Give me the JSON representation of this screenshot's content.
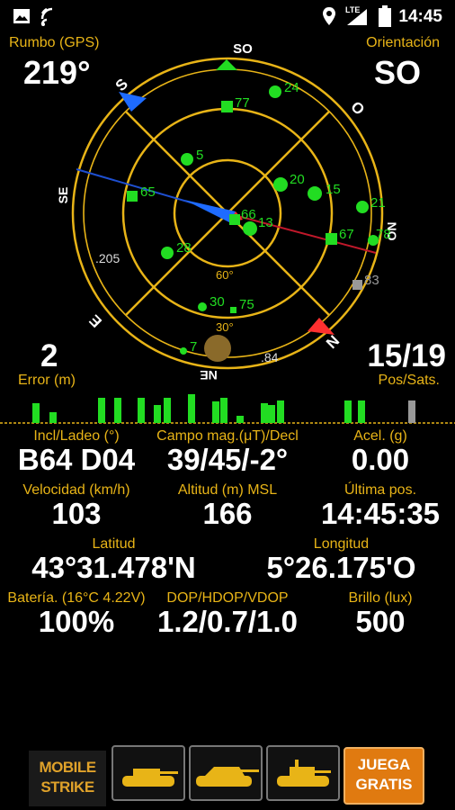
{
  "status_bar": {
    "time": "14:45",
    "lte_label": "LTE"
  },
  "header": {
    "heading_label": "Rumbo (GPS)",
    "heading_value": "219°",
    "orientation_label": "Orientación",
    "orientation_value": "SO"
  },
  "radar": {
    "cardinals": {
      "top": "SO",
      "left_top": "S",
      "right_top": "O",
      "left": "SE",
      "right": "NO",
      "left_bottom": "E",
      "right_bottom": "N",
      "bottom": "NE"
    },
    "ring_labels": {
      "inner": "60°",
      "outer": "30°"
    },
    "side_labels": {
      "left": ".205",
      "right_bottom": ".84"
    },
    "satellites": [
      {
        "id": "24"
      },
      {
        "id": "77"
      },
      {
        "id": "5"
      },
      {
        "id": "65"
      },
      {
        "id": "20"
      },
      {
        "id": "15"
      },
      {
        "id": "21"
      },
      {
        "id": "66"
      },
      {
        "id": "13"
      },
      {
        "id": "67"
      },
      {
        "id": "78"
      },
      {
        "id": "28"
      },
      {
        "id": "83"
      },
      {
        "id": "30"
      },
      {
        "id": "75"
      },
      {
        "id": "7"
      }
    ]
  },
  "mid": {
    "error_value": "2",
    "error_label": "Error (m)",
    "possats_value": "15/19",
    "possats_label": "Pos/Sats."
  },
  "signal_bars": [
    22,
    12,
    28,
    28,
    28,
    20,
    28,
    32,
    24,
    28,
    8,
    22,
    20,
    25,
    25,
    25,
    25,
    14,
    24,
    20
  ],
  "stats": {
    "r1": {
      "incl_label": "Incl/Ladeo (°)",
      "incl_value": "B64 D04",
      "mag_label": "Campo mag.(μT)/Decl",
      "mag_value": "39/45/-2°",
      "acel_label": "Acel. (g)",
      "acel_value": "0.00"
    },
    "r2": {
      "vel_label": "Velocidad (km/h)",
      "vel_value": "103",
      "alt_label": "Altitud (m) MSL",
      "alt_value": "166",
      "last_label": "Última pos.",
      "last_value": "14:45:35"
    },
    "r3": {
      "lat_label": "Latitud",
      "lat_value": "43°31.478'N",
      "lon_label": "Longitud",
      "lon_value": "5°26.175'O"
    },
    "r4": {
      "bat_label": "Batería. (16°C 4.22V)",
      "bat_value": "100%",
      "dop_label": "DOP/HDOP/VDOP",
      "dop_value": "1.2/0.7/1.0",
      "bri_label": "Brillo (lux)",
      "bri_value": "500"
    }
  },
  "ad": {
    "logo_line1": "MOBILE",
    "logo_line2": "STRIKE",
    "cta_line1": "JUEGA",
    "cta_line2": "GRATIS"
  },
  "colors": {
    "accent": "#e8b417",
    "sat": "#22dd22",
    "needle_blue": "#1e6bff",
    "needle_red": "#ff3030"
  }
}
